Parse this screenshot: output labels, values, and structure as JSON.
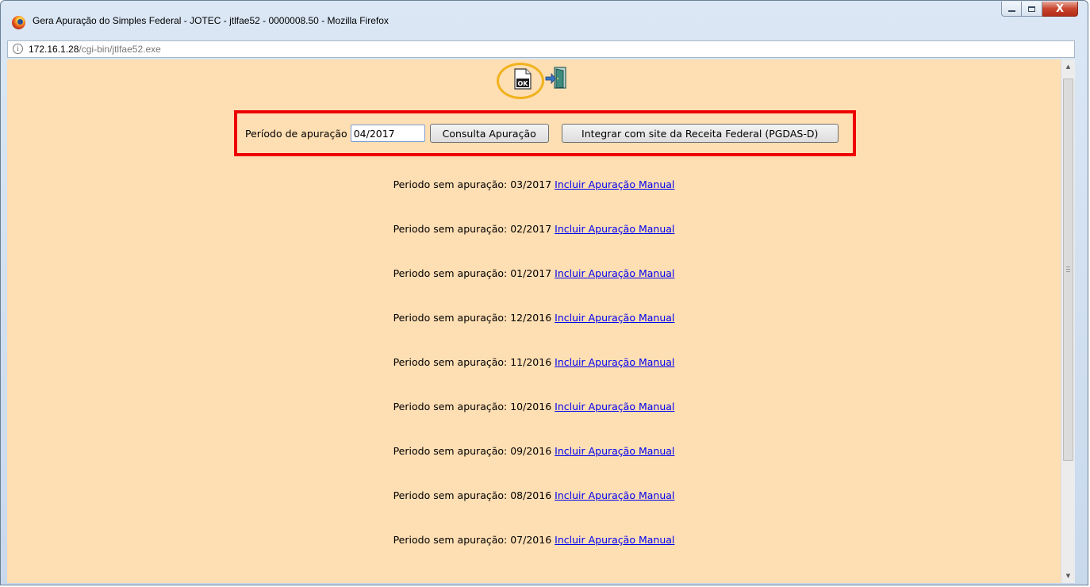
{
  "window": {
    "title": "Gera Apuração do Simples Federal - JOTEC - jtlfae52 - 0000008.50 - Mozilla Firefox",
    "controls": {
      "minimize": "minimize",
      "maximize": "maximize",
      "close": "X"
    }
  },
  "urlbar": {
    "host": "172.16.1.28",
    "path": "/cgi-bin/jtlfae52.exe"
  },
  "toolbar": {
    "ok_icon": "ok-document-icon",
    "exit_icon": "exit-door-icon",
    "ok_label": "OK",
    "highlight_color": "#f0b21c"
  },
  "form": {
    "period_label": "Período de apuração",
    "period_value": "04/2017",
    "consulta_button": "Consulta Apuração",
    "integrar_button": "Integrar com site da Receita Federal (PGDAS-D)",
    "highlight_color": "#ee0000"
  },
  "periods": [
    {
      "text": "Periodo sem apuração: 03/2017",
      "link": "Incluir Apuração Manual"
    },
    {
      "text": "Periodo sem apuração: 02/2017",
      "link": "Incluir Apuração Manual"
    },
    {
      "text": "Periodo sem apuração: 01/2017",
      "link": "Incluir Apuração Manual"
    },
    {
      "text": "Periodo sem apuração: 12/2016",
      "link": "Incluir Apuração Manual"
    },
    {
      "text": "Periodo sem apuração: 11/2016",
      "link": "Incluir Apuração Manual"
    },
    {
      "text": "Periodo sem apuração: 10/2016",
      "link": "Incluir Apuração Manual"
    },
    {
      "text": "Periodo sem apuração: 09/2016",
      "link": "Incluir Apuração Manual"
    },
    {
      "text": "Periodo sem apuração: 08/2016",
      "link": "Incluir Apuração Manual"
    },
    {
      "text": "Periodo sem apuração: 07/2016",
      "link": "Incluir Apuração Manual"
    }
  ],
  "colors": {
    "page_background": "#fedeb3",
    "link": "#0000ee"
  }
}
